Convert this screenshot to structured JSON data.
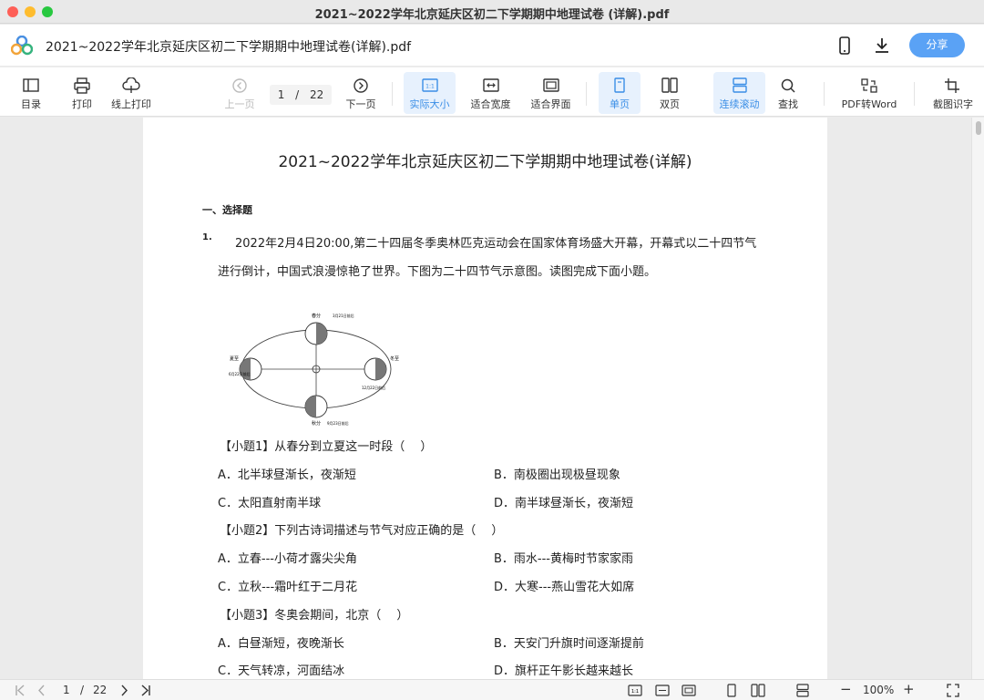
{
  "window": {
    "title": "2021~2022学年北京延庆区初二下学期期中地理试卷 (详解).pdf"
  },
  "appbar": {
    "doc_title": "2021~2022学年北京延庆区初二下学期期中地理试卷(详解).pdf",
    "share_label": "分享",
    "phone_icon": "phone-icon",
    "download_icon": "download-icon"
  },
  "toolbar": {
    "toc": "目录",
    "print": "打印",
    "online_print": "线上打印",
    "prev": "上一页",
    "page_current": "1",
    "page_sep": "/",
    "page_total": "22",
    "next": "下一页",
    "actual_size": "实际大小",
    "actual_size_icon_text": "1:1",
    "fit_width": "适合宽度",
    "fit_page": "适合界面",
    "single": "单页",
    "double": "双页",
    "continuous": "连续滚动",
    "find": "查找",
    "pdf2word": "PDF转Word",
    "ocr": "截图识字"
  },
  "document": {
    "title": "2021~2022学年北京延庆区初二下学期期中地理试卷(详解)",
    "section": "一、选择题",
    "q_number": "1.",
    "q_text_1": "2022年2月4日20:00,第二十四届冬季奥林匹克运动会在国家体育场盛大开幕，开幕式以二十四节气",
    "q_text_2": "进行倒计，中国式浪漫惊艳了世界。下图为二十四节气示意图。读图完成下面小题。",
    "sub1": "【小题1】从春分到立夏这一时段（　 ）",
    "sub1_a": "A．北半球昼渐长，夜渐短",
    "sub1_b": "B．南极圈出现极昼现象",
    "sub1_c": "C．太阳直射南半球",
    "sub1_d": "D．南半球昼渐长，夜渐短",
    "sub2": "【小题2】下列古诗词描述与节气对应正确的是（　 ）",
    "sub2_a": "A．立春---小荷才露尖尖角",
    "sub2_b": "B．雨水---黄梅时节家家雨",
    "sub2_c": "C．立秋---霜叶红于二月花",
    "sub2_d": "D．大寒---燕山雪花大如席",
    "sub3": "【小题3】冬奥会期间，北京（　 ）",
    "sub3_a": "A．白昼渐短，夜晚渐长",
    "sub3_b": "B．天安门升旗时间逐渐提前",
    "sub3_c": "C．天气转凉，河面结冰",
    "sub3_d": "D．旗杆正午影长越来越长",
    "diagram": {
      "chunfen": "春分",
      "chunfen_date": "3月21日前后",
      "xiazhi": "夏至",
      "xiazhi_date": "6月22日前后",
      "qiufen": "秋分",
      "qiufen_date": "9月23日前后",
      "dongzhi": "冬至",
      "dongzhi_date": "12月22日前后"
    }
  },
  "bottombar": {
    "page_current": "1",
    "page_sep": "/",
    "page_total": "22",
    "zoom": "100%",
    "zoom_out": "−",
    "zoom_in": "+",
    "actual_size_icon_text": "1:1"
  }
}
